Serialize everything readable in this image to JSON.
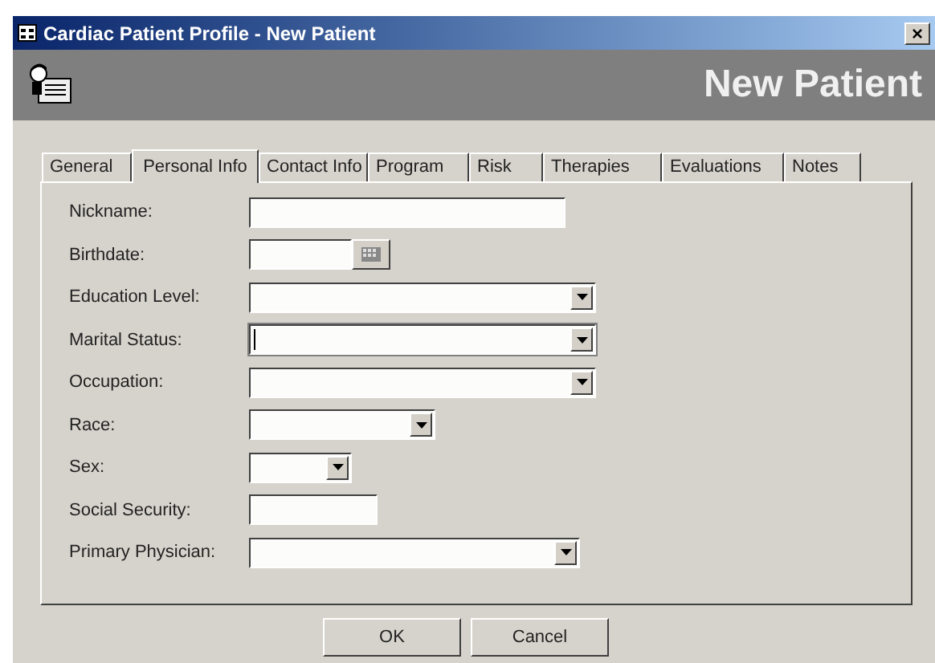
{
  "window": {
    "title": "Cardiac Patient Profile - New Patient",
    "close": "×"
  },
  "header": {
    "title": "New Patient"
  },
  "tabs": [
    {
      "label": "General",
      "selected": false
    },
    {
      "label": "Personal Info",
      "selected": true
    },
    {
      "label": "Contact Info",
      "selected": false
    },
    {
      "label": "Program",
      "selected": false
    },
    {
      "label": "Risk",
      "selected": false
    },
    {
      "label": "Therapies",
      "selected": false
    },
    {
      "label": "Evaluations",
      "selected": false
    },
    {
      "label": "Notes",
      "selected": false
    }
  ],
  "fields": [
    {
      "label": "Nickname:",
      "kind": "text",
      "focused": false
    },
    {
      "label": "Birthdate:",
      "kind": "date",
      "focused": false
    },
    {
      "label": "Education Level:",
      "kind": "combo",
      "focused": false
    },
    {
      "label": "Marital Status:",
      "kind": "combo",
      "focused": true
    },
    {
      "label": "Occupation:",
      "kind": "combo",
      "focused": false
    },
    {
      "label": "Race:",
      "kind": "combo",
      "focused": false
    },
    {
      "label": "Sex:",
      "kind": "combo",
      "focused": false
    },
    {
      "label": "Social Security:",
      "kind": "text",
      "focused": false
    },
    {
      "label": "Primary Physician:",
      "kind": "combo",
      "focused": false
    }
  ],
  "buttons": [
    {
      "label": "OK"
    },
    {
      "label": "Cancel"
    }
  ]
}
